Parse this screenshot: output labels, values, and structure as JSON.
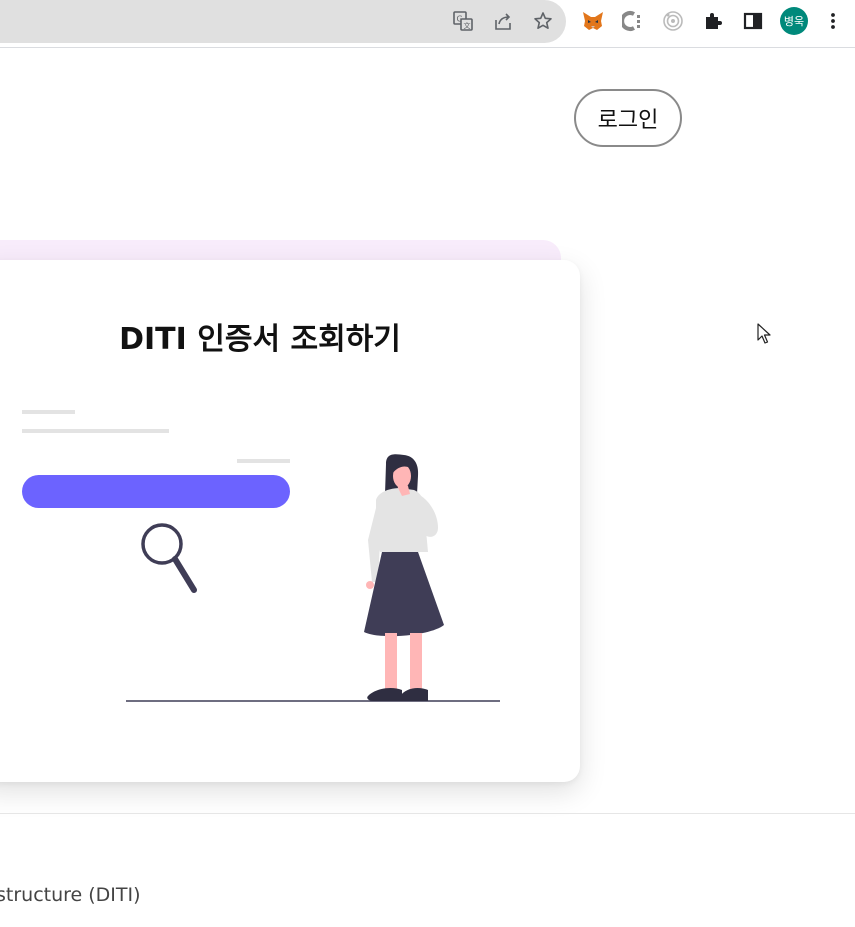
{
  "browser": {
    "avatar_text": "병욱",
    "icons": [
      "translate-icon",
      "share-icon",
      "bookmark-star-icon",
      "metamask-fox-icon",
      "c-extension-icon",
      "target-extension-icon",
      "extensions-puzzle-icon",
      "side-panel-icon",
      "avatar",
      "menu-kebab-icon"
    ]
  },
  "header": {
    "login_label": "로그인"
  },
  "card": {
    "title": "DITI 인증서 조회하기"
  },
  "footer": {
    "text": "structure (DITI)"
  },
  "colors": {
    "accent": "#6c63ff",
    "dark": "#3f3d56",
    "skin": "#ffb6b6",
    "tab_tint": "#f8ecfb",
    "avatar_bg": "#00897b"
  }
}
